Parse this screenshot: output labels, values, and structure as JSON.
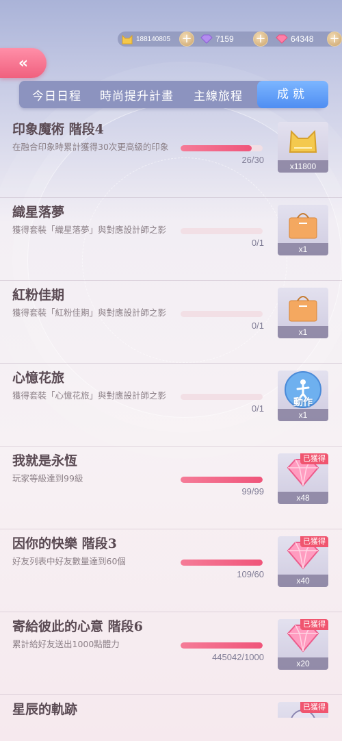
{
  "currencies": {
    "gold": {
      "icon": "cat-coin-icon",
      "value": "188140805"
    },
    "purple_diamond": {
      "icon": "purple-diamond-icon",
      "value": "7159"
    },
    "pink_diamond": {
      "icon": "pink-diamond-icon",
      "value": "64348"
    }
  },
  "back_label": "«",
  "tabs": [
    "今日日程",
    "時尚提升計畫",
    "主線旅程",
    "成就"
  ],
  "active_tab": 3,
  "achievements": [
    {
      "title": "印象魔術 階段4",
      "desc": "在融合印象時累計獲得30次更高級的印象",
      "progress": 0.87,
      "count": "26/30",
      "reward_qty": "x11800",
      "reward_icon": "gold-cat-coin-icon",
      "obtained": ""
    },
    {
      "title": "織星落夢",
      "desc": "獲得套裝「織星落夢」與對應設計師之影",
      "progress": 0,
      "count": "0/1",
      "reward_qty": "x1",
      "reward_icon": "gift-bag-icon",
      "obtained": ""
    },
    {
      "title": "紅粉佳期",
      "desc": "獲得套裝「紅粉佳期」與對應設計師之影",
      "progress": 0,
      "count": "0/1",
      "reward_qty": "x1",
      "reward_icon": "gift-bag-icon",
      "obtained": ""
    },
    {
      "title": "心憶花旅",
      "desc": "獲得套裝「心憶花旅」與對應設計師之影",
      "progress": 0,
      "count": "0/1",
      "reward_qty": "x1",
      "reward_icon": "action-icon",
      "reward_label": "動作",
      "obtained": ""
    },
    {
      "title": "我就是永恆",
      "desc": "玩家等級達到99級",
      "progress": 1,
      "count": "99/99",
      "reward_qty": "x48",
      "reward_icon": "pink-diamond-icon",
      "obtained": "已獲得"
    },
    {
      "title": "因你的快樂 階段3",
      "desc": "好友列表中好友數量達到60個",
      "progress": 1,
      "count": "109/60",
      "reward_qty": "x40",
      "reward_icon": "pink-diamond-icon",
      "obtained": "已獲得"
    },
    {
      "title": "寄給彼此的心意 階段6",
      "desc": "累計給好友送出1000點體力",
      "progress": 1,
      "count": "445042/1000",
      "reward_qty": "x20",
      "reward_icon": "pink-diamond-icon",
      "obtained": "已獲得"
    },
    {
      "title": "星辰的軌跡",
      "desc": "",
      "progress": 1,
      "count": "",
      "reward_qty": "",
      "reward_icon": "compass-icon",
      "obtained": "已獲得"
    }
  ],
  "colors": {
    "accent_pink": "#f0557a",
    "tab_active": "#4f8ef2",
    "tab_bg": "#8c93bf"
  }
}
